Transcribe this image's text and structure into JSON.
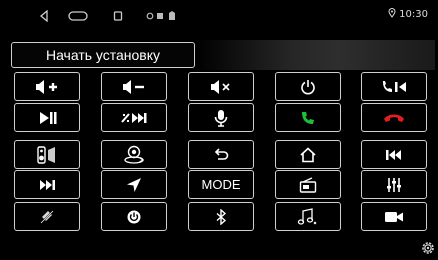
{
  "status_bar": {
    "time": "10:30",
    "icons": [
      "back-icon",
      "home-icon",
      "recent-apps-icon",
      "notification-icons",
      "location-icon"
    ]
  },
  "install_button": {
    "label": "Начать установку"
  },
  "keys": {
    "mode_label": "MODE"
  },
  "colors": {
    "call_green": "#1fbf3a",
    "hangup_red": "#e02020",
    "border": "#cfcfcf",
    "background": "#000000"
  },
  "icons": [
    "volume-up-icon",
    "volume-down-icon",
    "mute-icon",
    "power-icon",
    "call-prev-icon",
    "play-pause-icon",
    "mute-next-icon",
    "voice-icon",
    "call-answer-icon",
    "hang-up-icon",
    "speaker-icon",
    "camera-360-icon",
    "back-icon",
    "home-icon",
    "prev-track-icon",
    "next-track-icon",
    "navigation-icon",
    "mode-label",
    "radio-icon",
    "equalizer-icon",
    "mute-mic-icon",
    "power-cycle-icon",
    "bluetooth-icon",
    "music-icon",
    "camera-icon"
  ]
}
